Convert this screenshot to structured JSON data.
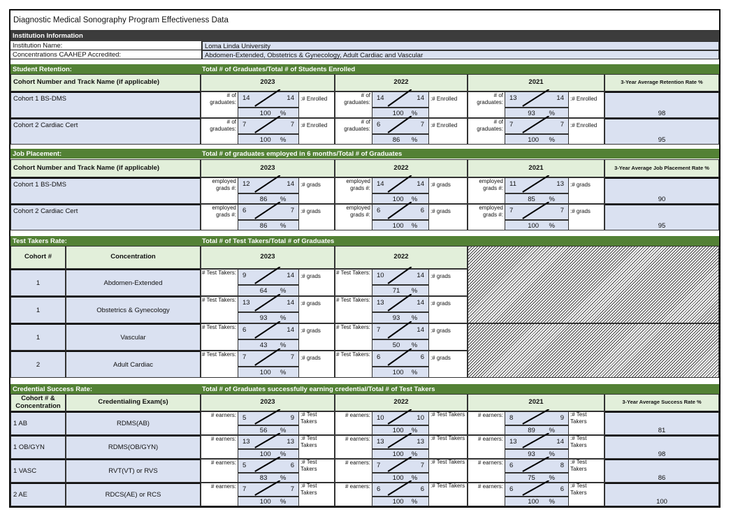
{
  "title": "Diagnostic Medical Sonography Program Effectiveness Data",
  "institution": {
    "section_label": "Institution Information",
    "name_label": "Institution Name:",
    "name_value": "Loma Linda University",
    "conc_label": "Concentrations CAAHEP Accredited:",
    "conc_value": "Abdomen-Extended, Obstetrics & Gynecology, Adult Cardiac and Vascular"
  },
  "retention": {
    "section_label": "Student Retention:",
    "formula": "Total # of Graduates/Total # of Students Enrolled",
    "col_header": "Cohort Number and Track Name (if applicable)",
    "years": [
      "2023",
      "2022",
      "2021"
    ],
    "avg_header": "3-Year Average Retention Rate %",
    "pre_label": "# of graduates:",
    "suffix": ":# Enrolled",
    "rows": [
      {
        "name": "Cohort 1 BS-DMS",
        "cells": [
          {
            "n": "14",
            "d": "14",
            "p": "100"
          },
          {
            "n": "14",
            "d": "14",
            "p": "100"
          },
          {
            "n": "13",
            "d": "14",
            "p": "93"
          }
        ],
        "avg": "98"
      },
      {
        "name": "Cohort 2 Cardiac Cert",
        "cells": [
          {
            "n": "7",
            "d": "7",
            "p": "100"
          },
          {
            "n": "6",
            "d": "7",
            "p": "86"
          },
          {
            "n": "7",
            "d": "7",
            "p": "100"
          }
        ],
        "avg": "95"
      }
    ]
  },
  "job": {
    "section_label": "Job Placement:",
    "formula": "Total # of graduates employed in 6 months/Total # of Graduates",
    "col_header": "Cohort Number and Track Name (if applicable)",
    "years": [
      "2023",
      "2022",
      "2021"
    ],
    "avg_header": "3-Year Average Job Placement Rate %",
    "pre_label": "employed grads #:",
    "suffixes": [
      ":# grads",
      ":# grads",
      ":# grads"
    ],
    "rows": [
      {
        "name": "Cohort 1 BS-DMS",
        "cells": [
          {
            "n": "12",
            "d": "14",
            "p": "86"
          },
          {
            "n": "14",
            "d": "14",
            "p": "100"
          },
          {
            "n": "11",
            "d": "13",
            "p": "85"
          }
        ],
        "avg": "90"
      },
      {
        "name": "Cohort 2 Cardiac Cert",
        "cells": [
          {
            "n": "6",
            "d": "7",
            "p": "86"
          },
          {
            "n": "6",
            "d": "6",
            "p": "100"
          },
          {
            "n": "7",
            "d": "7",
            "p": "100"
          }
        ],
        "avg": "95"
      }
    ]
  },
  "testtakers": {
    "section_label": "Test Takers Rate:",
    "formula": "Total # of Test Takers/Total # of Graduates",
    "col_cohort": "Cohort #",
    "col_conc": "Concentration",
    "years": [
      "2023",
      "2022"
    ],
    "pre_label": "# Test Takers:",
    "suffix": ":# grads",
    "rows": [
      {
        "cohort": "1",
        "conc": "Abdomen-Extended",
        "cells": [
          {
            "n": "9",
            "d": "14",
            "p": "64"
          },
          {
            "n": "10",
            "d": "14",
            "p": "71"
          }
        ]
      },
      {
        "cohort": "1",
        "conc": "Obstetrics & Gynecology",
        "cells": [
          {
            "n": "13",
            "d": "14",
            "p": "93"
          },
          {
            "n": "13",
            "d": "14",
            "p": "93"
          }
        ]
      },
      {
        "cohort": "1",
        "conc": "Vascular",
        "cells": [
          {
            "n": "6",
            "d": "14",
            "p": "43"
          },
          {
            "n": "7",
            "d": "14",
            "p": "50"
          }
        ]
      },
      {
        "cohort": "2",
        "conc": "Adult Cardiac",
        "cells": [
          {
            "n": "7",
            "d": "7",
            "p": "100"
          },
          {
            "n": "6",
            "d": "6",
            "p": "100"
          }
        ]
      }
    ]
  },
  "credential": {
    "section_label": "Credential Success Rate:",
    "formula": "Total # of Graduates successfully earning credential/Total # of Test Takers",
    "col_cohort": "Cohort # & Concentration",
    "col_exam": "Credentialing Exam(s)",
    "years": [
      "2023",
      "2022",
      "2021"
    ],
    "avg_header": "3-Year Average Success Rate %",
    "pre_label": "# earners:",
    "suffix": ":# Test Takers",
    "rows": [
      {
        "cohort": "1 AB",
        "exam": "RDMS(AB)",
        "cells": [
          {
            "n": "5",
            "d": "9",
            "p": "56"
          },
          {
            "n": "10",
            "d": "10",
            "p": "100"
          },
          {
            "n": "8",
            "d": "9",
            "p": "89"
          }
        ],
        "avg": "81"
      },
      {
        "cohort": "1 OB/GYN",
        "exam": "RDMS(OB/GYN)",
        "cells": [
          {
            "n": "13",
            "d": "13",
            "p": "100"
          },
          {
            "n": "13",
            "d": "13",
            "p": "100"
          },
          {
            "n": "13",
            "d": "14",
            "p": "93"
          }
        ],
        "avg": "98"
      },
      {
        "cohort": "1 VASC",
        "exam": "RVT(VT) or RVS",
        "cells": [
          {
            "n": "5",
            "d": "6",
            "p": "83"
          },
          {
            "n": "7",
            "d": "7",
            "p": "100"
          },
          {
            "n": "6",
            "d": "8",
            "p": "75"
          }
        ],
        "avg": "86"
      },
      {
        "cohort": "2 AE",
        "exam": "RDCS(AE) or RCS",
        "cells": [
          {
            "n": "7",
            "d": "7",
            "p": "100"
          },
          {
            "n": "6",
            "d": "6",
            "p": "100"
          },
          {
            "n": "6",
            "d": "6",
            "p": "100"
          }
        ],
        "avg": "100"
      }
    ]
  },
  "pct_symbol": "%"
}
